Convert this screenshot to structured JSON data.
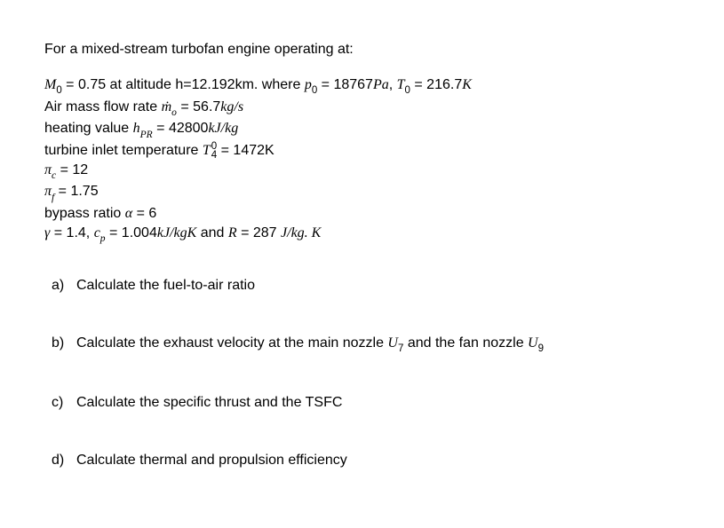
{
  "intro": "For a mixed-stream turbofan engine operating at:",
  "params": {
    "l1_a": "M",
    "l1_b": "0",
    "l1_c": " = 0.75 at altitude h=12.192km. where ",
    "l1_d": "p",
    "l1_e": "0",
    "l1_f": " = 18767",
    "l1_g": "Pa",
    "l1_h": ", ",
    "l1_i": "T",
    "l1_j": "0",
    "l1_k": " = 216.7",
    "l1_l": "K",
    "l2_a": "Air mass flow rate ",
    "l2_b": "ṁ",
    "l2_c": "o",
    "l2_d": " = 56.7",
    "l2_e": "kg/s",
    "l3_a": "heating value ",
    "l3_b": "h",
    "l3_c": "PR",
    "l3_d": " = 42800",
    "l3_e": "kJ/kg",
    "l4_a": "turbine inlet temperature ",
    "l4_b": "T",
    "l4_c": "0",
    "l4_d": "4",
    "l4_e": " = 1472K",
    "l5_a": "π",
    "l5_b": "c",
    "l5_c": " = 12",
    "l6_a": "π",
    "l6_b": "f",
    "l6_c": " = 1.75",
    "l7_a": "bypass ratio ",
    "l7_b": "α",
    "l7_c": " = 6",
    "l8_a": "γ",
    "l8_b": " = 1.4, ",
    "l8_c": "c",
    "l8_d": "p",
    "l8_e": " = 1.004",
    "l8_f": "kJ/kgK",
    "l8_g": " and ",
    "l8_h": "R",
    "l8_i": "  =  287 ",
    "l8_j": "J/kg. K"
  },
  "q": {
    "a_letter": "a)",
    "a_text1": "Calculate the fuel-to-air ratio",
    "b_letter": "b)",
    "b_text1": "Calculate the exhaust velocity at the main nozzle ",
    "b_u7a": "U",
    "b_u7b": "7",
    "b_text2": " and the fan nozzle ",
    "b_u9a": "U",
    "b_u9b": "9",
    "c_letter": "c)",
    "c_text1": "Calculate the specific thrust and the TSFC",
    "d_letter": "d)",
    "d_text1": "Calculate thermal and propulsion efficiency"
  }
}
